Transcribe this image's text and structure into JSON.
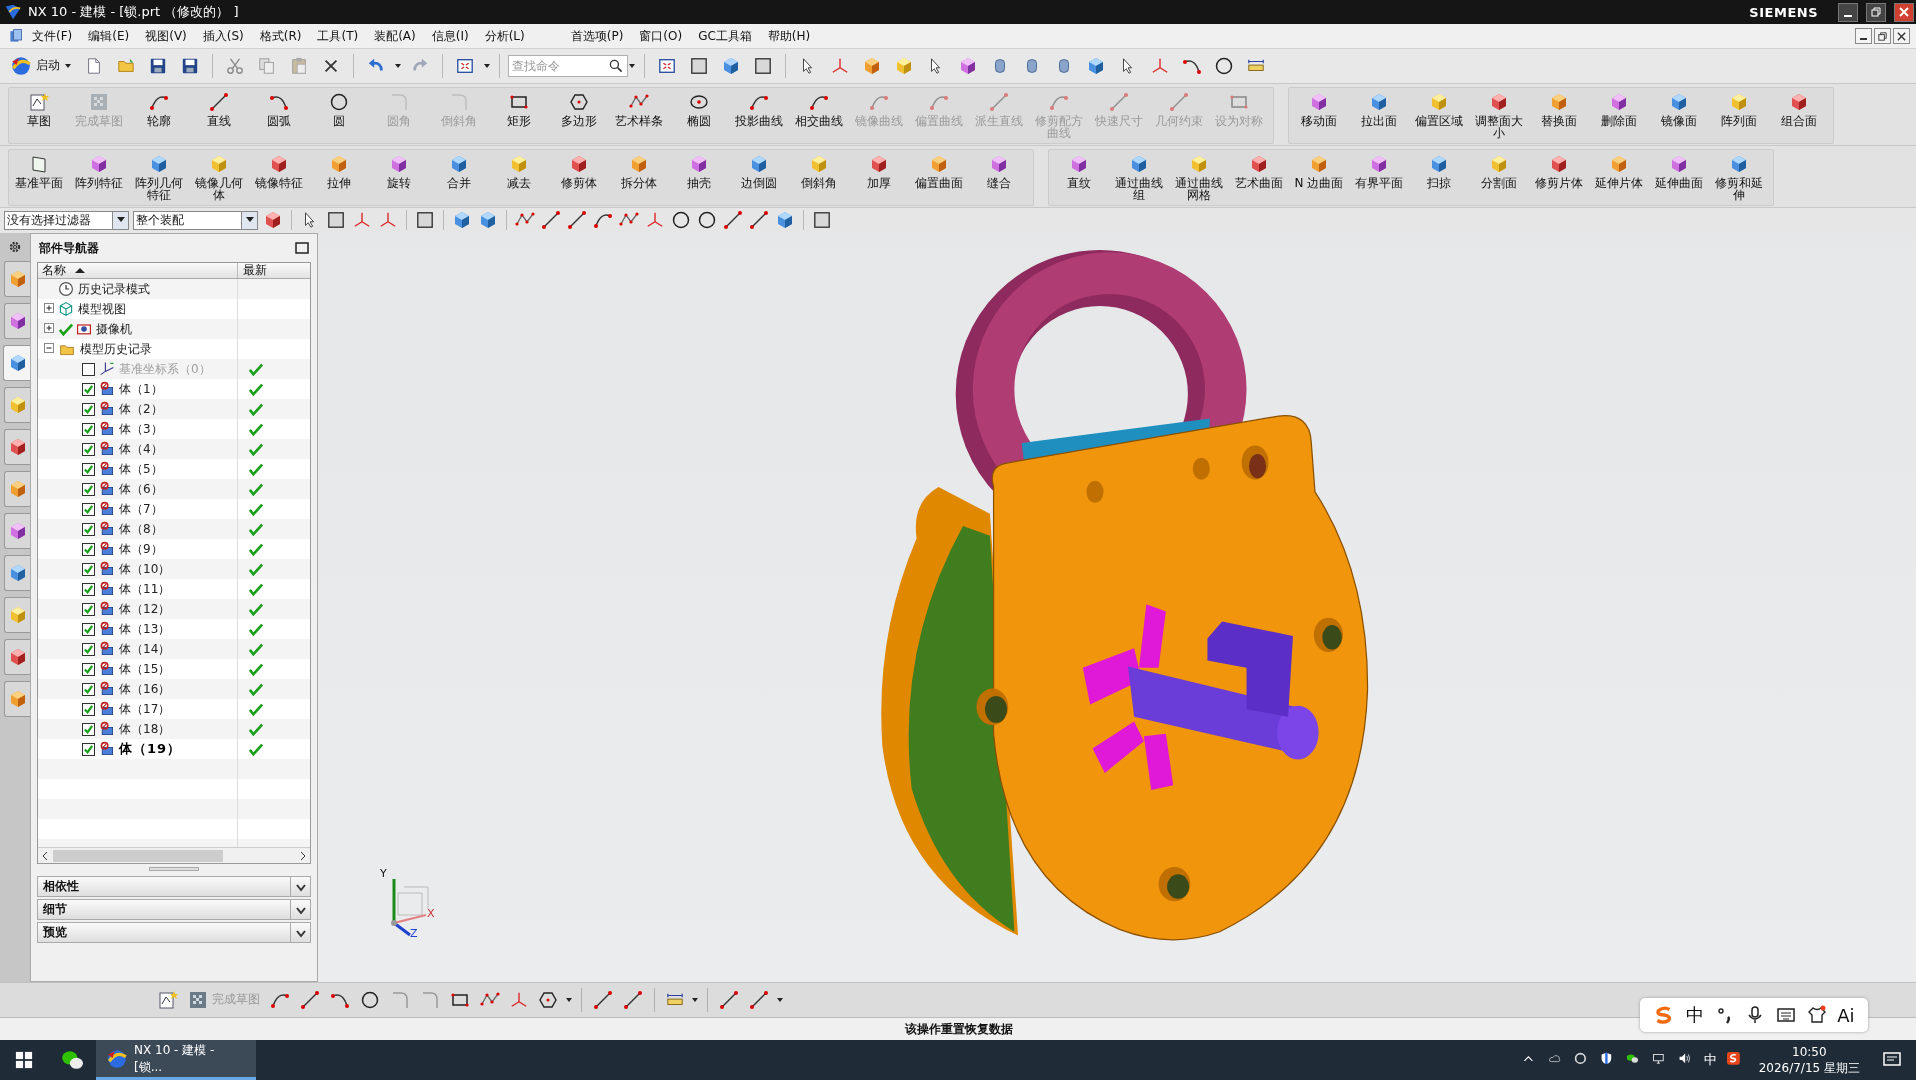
{
  "window": {
    "title": "NX 10 - 建模 - [锁.prt （修改的） ]",
    "brand": "SIEMENS"
  },
  "menu": [
    "文件(F)",
    "编辑(E)",
    "视图(V)",
    "插入(S)",
    "格式(R)",
    "工具(T)",
    "装配(A)",
    "信息(I)",
    "分析(L)",
    "首选项(P)",
    "窗口(O)",
    "GC工具箱",
    "帮助(H)"
  ],
  "standard_toolbar": {
    "start_label": "启动",
    "search": {
      "placeholder": "查找命令"
    }
  },
  "ribbon": {
    "rows": [
      {
        "groups": [
          {
            "items": [
              {
                "label": "草图",
                "disabled": false
              },
              {
                "label": "完成草图",
                "disabled": true
              },
              {
                "label": "轮廓",
                "disabled": false
              },
              {
                "label": "直线",
                "disabled": false
              },
              {
                "label": "圆弧",
                "disabled": false
              },
              {
                "label": "圆",
                "disabled": false
              },
              {
                "label": "圆角",
                "disabled": true
              },
              {
                "label": "倒斜角",
                "disabled": true
              },
              {
                "label": "矩形",
                "disabled": false
              },
              {
                "label": "多边形",
                "disabled": false
              },
              {
                "label": "艺术样条",
                "disabled": false
              },
              {
                "label": "椭圆",
                "disabled": false
              },
              {
                "label": "投影曲线",
                "disabled": false
              },
              {
                "label": "相交曲线",
                "disabled": false
              },
              {
                "label": "镜像曲线",
                "disabled": true
              },
              {
                "label": "偏置曲线",
                "disabled": true
              },
              {
                "label": "派生直线",
                "disabled": true
              },
              {
                "label": "修剪配方曲线",
                "disabled": true
              },
              {
                "label": "快速尺寸",
                "disabled": true
              },
              {
                "label": "几何约束",
                "disabled": true
              },
              {
                "label": "设为对称",
                "disabled": true
              }
            ]
          },
          {
            "items": [
              {
                "label": "移动面",
                "disabled": false
              },
              {
                "label": "拉出面",
                "disabled": false
              },
              {
                "label": "偏置区域",
                "disabled": false
              },
              {
                "label": "调整面大小",
                "disabled": false
              },
              {
                "label": "替换面",
                "disabled": false
              },
              {
                "label": "删除面",
                "disabled": false
              },
              {
                "label": "镜像面",
                "disabled": false
              },
              {
                "label": "阵列面",
                "disabled": false
              },
              {
                "label": "组合面",
                "disabled": false
              }
            ]
          }
        ]
      },
      {
        "groups": [
          {
            "items": [
              {
                "label": "基准平面",
                "disabled": false
              },
              {
                "label": "阵列特征",
                "disabled": false
              },
              {
                "label": "阵列几何特征",
                "disabled": false
              },
              {
                "label": "镜像几何体",
                "disabled": false
              },
              {
                "label": "镜像特征",
                "disabled": false
              },
              {
                "label": "拉伸",
                "disabled": false
              },
              {
                "label": "旋转",
                "disabled": false
              },
              {
                "label": "合并",
                "disabled": false
              },
              {
                "label": "减去",
                "disabled": false
              },
              {
                "label": "修剪体",
                "disabled": false
              },
              {
                "label": "拆分体",
                "disabled": false
              },
              {
                "label": "抽壳",
                "disabled": false
              },
              {
                "label": "边倒圆",
                "disabled": false
              },
              {
                "label": "倒斜角",
                "disabled": false
              },
              {
                "label": "加厚",
                "disabled": false
              },
              {
                "label": "偏置曲面",
                "disabled": false
              },
              {
                "label": "缝合",
                "disabled": false
              }
            ]
          },
          {
            "items": [
              {
                "label": "直纹",
                "disabled": false
              },
              {
                "label": "通过曲线组",
                "disabled": false
              },
              {
                "label": "通过曲线网格",
                "disabled": false
              },
              {
                "label": "艺术曲面",
                "disabled": false
              },
              {
                "label": "N 边曲面",
                "disabled": false
              },
              {
                "label": "有界平面",
                "disabled": false
              },
              {
                "label": "扫掠",
                "disabled": false
              },
              {
                "label": "分割面",
                "disabled": false
              },
              {
                "label": "修剪片体",
                "disabled": false
              },
              {
                "label": "延伸片体",
                "disabled": false
              },
              {
                "label": "延伸曲面",
                "disabled": false
              },
              {
                "label": "修剪和延伸",
                "disabled": false
              }
            ]
          }
        ]
      }
    ]
  },
  "selection_bar": {
    "filters": [
      {
        "value": "没有选择过滤器"
      },
      {
        "value": "整个装配"
      }
    ]
  },
  "resource_tabs": [
    {
      "selected": false
    },
    {
      "selected": false
    },
    {
      "selected": true
    },
    {
      "selected": false
    },
    {
      "selected": false
    },
    {
      "selected": false
    },
    {
      "selected": false
    },
    {
      "selected": false
    },
    {
      "selected": false
    },
    {
      "selected": false
    },
    {
      "selected": false
    }
  ],
  "navigator": {
    "title": "部件导航器",
    "columns": [
      "名称",
      "最新"
    ],
    "nodes": [
      {
        "kind": "clock",
        "label": "历史记录模式",
        "latest": false
      },
      {
        "kind": "view",
        "label": "模型视图",
        "expanded": false,
        "latest": false
      },
      {
        "kind": "camera",
        "label": "摄像机",
        "expanded": false,
        "checked": true,
        "latest": false
      },
      {
        "kind": "folder",
        "label": "模型历史记录",
        "expanded": true,
        "latest": false,
        "children": [
          {
            "kind": "csys",
            "label": "基准坐标系（0）",
            "checked": false,
            "disabled": true,
            "current": false,
            "latest": true
          },
          {
            "kind": "body",
            "label": "体（1）",
            "checked": true,
            "disabled": false,
            "current": false,
            "latest": true
          },
          {
            "kind": "body",
            "label": "体（2）",
            "checked": true,
            "disabled": false,
            "current": false,
            "latest": true
          },
          {
            "kind": "body",
            "label": "体（3）",
            "checked": true,
            "disabled": false,
            "current": false,
            "latest": true
          },
          {
            "kind": "body",
            "label": "体（4）",
            "checked": true,
            "disabled": false,
            "current": false,
            "latest": true
          },
          {
            "kind": "body",
            "label": "体（5）",
            "checked": true,
            "disabled": false,
            "current": false,
            "latest": true
          },
          {
            "kind": "body",
            "label": "体（6）",
            "checked": true,
            "disabled": false,
            "current": false,
            "latest": true
          },
          {
            "kind": "body",
            "label": "体（7）",
            "checked": true,
            "disabled": false,
            "current": false,
            "latest": true
          },
          {
            "kind": "body",
            "label": "体（8）",
            "checked": true,
            "disabled": false,
            "current": false,
            "latest": true
          },
          {
            "kind": "body",
            "label": "体（9）",
            "checked": true,
            "disabled": false,
            "current": false,
            "latest": true
          },
          {
            "kind": "body",
            "label": "体（10）",
            "checked": true,
            "disabled": false,
            "current": false,
            "latest": true
          },
          {
            "kind": "body",
            "label": "体（11）",
            "checked": true,
            "disabled": false,
            "current": false,
            "latest": true
          },
          {
            "kind": "body",
            "label": "体（12）",
            "checked": true,
            "disabled": false,
            "current": false,
            "latest": true
          },
          {
            "kind": "body",
            "label": "体（13）",
            "checked": true,
            "disabled": false,
            "current": false,
            "latest": true
          },
          {
            "kind": "body",
            "label": "体（14）",
            "checked": true,
            "disabled": false,
            "current": false,
            "latest": true
          },
          {
            "kind": "body",
            "label": "体（15）",
            "checked": true,
            "disabled": false,
            "current": false,
            "latest": true
          },
          {
            "kind": "body",
            "label": "体（16）",
            "checked": true,
            "disabled": false,
            "current": false,
            "latest": true
          },
          {
            "kind": "body",
            "label": "体（17）",
            "checked": true,
            "disabled": false,
            "current": false,
            "latest": true
          },
          {
            "kind": "body",
            "label": "体（18）",
            "checked": true,
            "disabled": false,
            "current": false,
            "latest": true
          },
          {
            "kind": "body",
            "label": "体（19）",
            "checked": true,
            "disabled": false,
            "current": true,
            "latest": true
          }
        ]
      }
    ]
  },
  "panels": [
    {
      "title": "相依性",
      "expanded": false
    },
    {
      "title": "细节",
      "expanded": false
    },
    {
      "title": "预览",
      "expanded": false
    }
  ],
  "viewport": {
    "triad_labels": [
      "Y",
      "X",
      "Z"
    ]
  },
  "sketch_toolbar": {
    "items": [
      {
        "label": "完成草图",
        "disabled": true
      }
    ]
  },
  "status_bar": {
    "message": "该操作重置恢复数据"
  },
  "input_method": {
    "mode": "中",
    "ai_label": "Ai"
  },
  "taskbar": {
    "task": {
      "label": "NX 10 - 建模 - [锁...",
      "selected": true
    },
    "tray_language": "中",
    "time": "10:50",
    "date": "2026/7/15 星期三"
  }
}
